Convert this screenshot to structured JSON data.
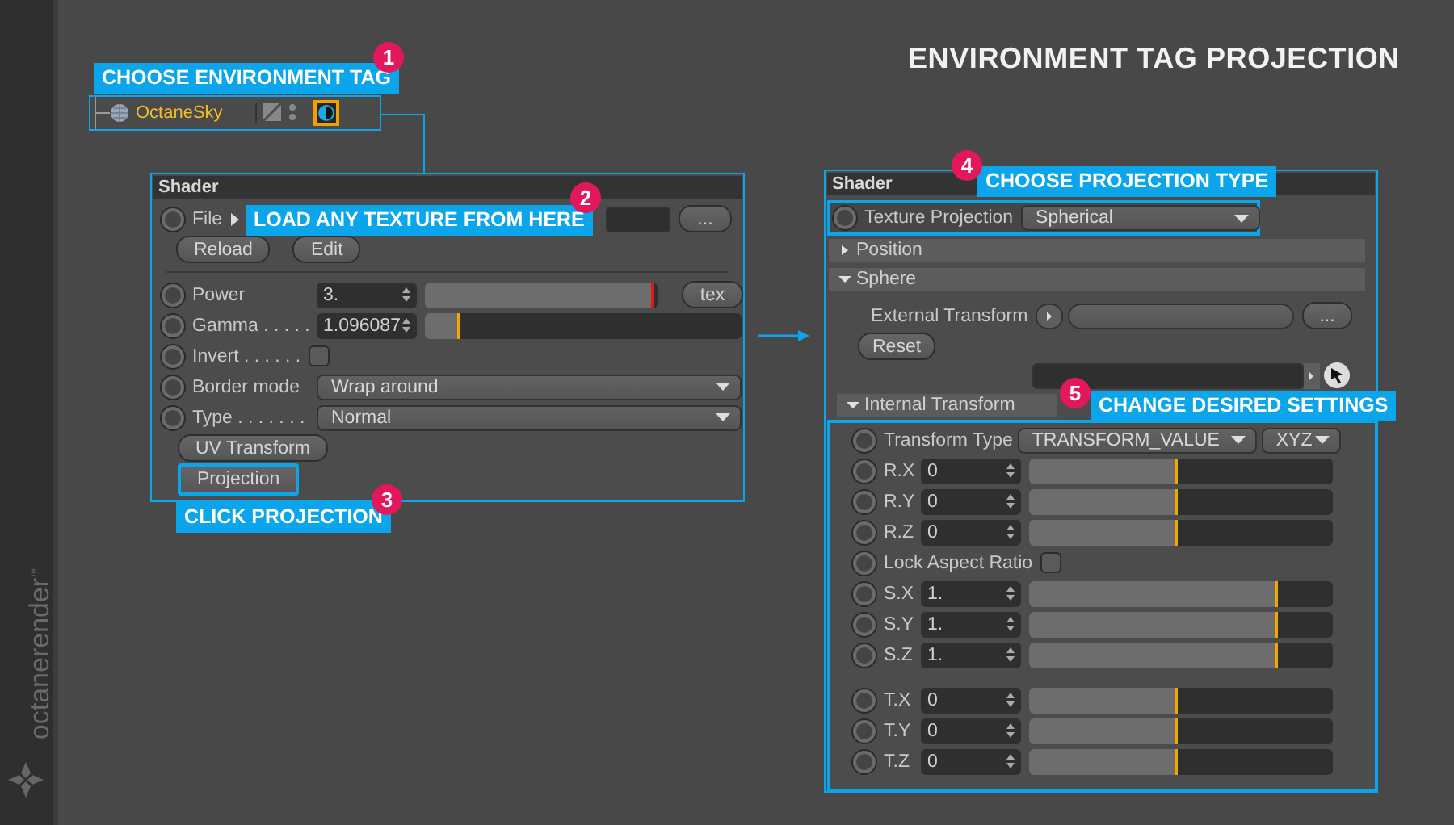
{
  "logo": {
    "name": "octanerender",
    "mark": "™"
  },
  "title": "ENVIRONMENT TAG PROJECTION",
  "callouts": [
    {
      "number": "1",
      "text": "CHOOSE ENVIRONMENT TAG"
    },
    {
      "number": "2",
      "text": "LOAD ANY TEXTURE FROM HERE"
    },
    {
      "number": "3",
      "text": "CLICK PROJECTION"
    },
    {
      "number": "4",
      "text": "CHOOSE PROJECTION TYPE"
    },
    {
      "number": "5",
      "text": "CHANGE DESIRED SETTINGS"
    }
  ],
  "object_row": {
    "name": "OctaneSky",
    "tag_selected": true
  },
  "left_panel": {
    "header": "Shader",
    "file": {
      "label": "File",
      "button": "...",
      "keyframed": false
    },
    "file_buttons": [
      "Reload",
      "Edit"
    ],
    "params": [
      {
        "kind": "slider",
        "label": "Power",
        "value": "3.",
        "level": 0.985,
        "color": "#e01818",
        "button": "tex",
        "keyframed": false
      },
      {
        "kind": "slider",
        "label": "Gamma . . . . .",
        "value": "1.096087",
        "level": 0.11,
        "color": "#f0a800",
        "keyframed": false
      },
      {
        "kind": "checkbox",
        "label": "Invert . . . . . .",
        "checked": false,
        "keyframed": false
      },
      {
        "kind": "dropdown",
        "label": "Border mode",
        "value": "Wrap around",
        "keyframed": false
      },
      {
        "kind": "dropdown",
        "label": "Type . . . . . . .",
        "value": "Normal",
        "keyframed": false
      }
    ],
    "buttons": [
      {
        "label": "UV Transform",
        "highlighted": false
      },
      {
        "label": "Projection",
        "highlighted": true
      }
    ]
  },
  "right_panel": {
    "header": "Shader",
    "projection": {
      "label": "Texture Projection",
      "value": "Spherical",
      "keyframed": false
    },
    "sections": [
      {
        "label": "Position",
        "expanded": false
      },
      {
        "label": "Sphere",
        "expanded": true
      }
    ],
    "external_transform": {
      "label": "External Transform",
      "button": "..."
    },
    "reset": "Reset",
    "internal_transform": {
      "label": "Internal Transform",
      "expanded": true
    },
    "transform_type": {
      "label": "Transform Type",
      "value": "TRANSFORM_VALUE",
      "order": "XYZ",
      "keyframed": false
    },
    "groups": [
      [
        {
          "kind": "slider",
          "label": "R.X",
          "value": "0",
          "level": 0.49,
          "keyframed": false
        },
        {
          "kind": "slider",
          "label": "R.Y",
          "value": "0",
          "level": 0.49,
          "keyframed": false
        },
        {
          "kind": "slider",
          "label": "R.Z",
          "value": "0",
          "level": 0.49,
          "keyframed": false
        },
        {
          "kind": "checkbox",
          "label": "Lock Aspect Ratio",
          "checked": false,
          "keyframed": false
        },
        {
          "kind": "slider",
          "label": "S.X",
          "value": "1.",
          "level": 0.82,
          "keyframed": false
        },
        {
          "kind": "slider",
          "label": "S.Y",
          "value": "1.",
          "level": 0.82,
          "keyframed": false
        },
        {
          "kind": "slider",
          "label": "S.Z",
          "value": "1.",
          "level": 0.82,
          "keyframed": false
        }
      ],
      [
        {
          "kind": "slider",
          "label": "T.X",
          "value": "0",
          "level": 0.49,
          "keyframed": false
        },
        {
          "kind": "slider",
          "label": "T.Y",
          "value": "0",
          "level": 0.49,
          "keyframed": false
        },
        {
          "kind": "slider",
          "label": "T.Z",
          "value": "0",
          "level": 0.49,
          "keyframed": false
        }
      ]
    ]
  }
}
